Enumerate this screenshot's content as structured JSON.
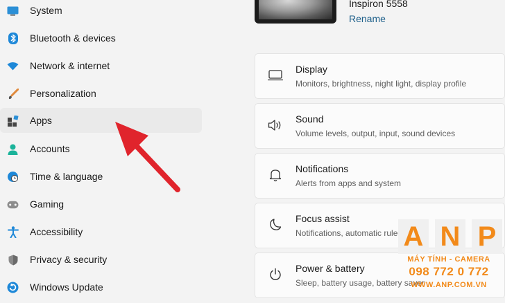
{
  "sidebar": {
    "items": [
      {
        "label": "System",
        "icon": "system-icon"
      },
      {
        "label": "Bluetooth & devices",
        "icon": "bluetooth-icon"
      },
      {
        "label": "Network & internet",
        "icon": "wifi-icon"
      },
      {
        "label": "Personalization",
        "icon": "brush-icon"
      },
      {
        "label": "Apps",
        "icon": "apps-icon"
      },
      {
        "label": "Accounts",
        "icon": "person-icon"
      },
      {
        "label": "Time & language",
        "icon": "clock-globe-icon"
      },
      {
        "label": "Gaming",
        "icon": "gamepad-icon"
      },
      {
        "label": "Accessibility",
        "icon": "accessibility-icon"
      },
      {
        "label": "Privacy & security",
        "icon": "shield-icon"
      },
      {
        "label": "Windows Update",
        "icon": "update-icon"
      }
    ],
    "active": "Apps"
  },
  "device": {
    "name": "Inspiron 5558",
    "rename_label": "Rename"
  },
  "cards": [
    {
      "title": "Display",
      "desc": "Monitors, brightness, night light, display profile",
      "icon": "display-icon"
    },
    {
      "title": "Sound",
      "desc": "Volume levels, output, input, sound devices",
      "icon": "speaker-icon"
    },
    {
      "title": "Notifications",
      "desc": "Alerts from apps and system",
      "icon": "bell-icon"
    },
    {
      "title": "Focus assist",
      "desc": "Notifications, automatic rules",
      "icon": "moon-icon"
    },
    {
      "title": "Power & battery",
      "desc": "Sleep, battery usage, battery saver",
      "icon": "power-icon"
    }
  ],
  "watermark": {
    "letters": [
      "A",
      "N",
      "P"
    ],
    "line1": "MÁY TÍNH - CAMERA",
    "line2": "098 772 0 772",
    "line3": "WWW.ANP.COM.VN",
    "color": "#f28a1a"
  },
  "colors": {
    "accent": "#0067c0",
    "link": "#1d5f8a",
    "annotation_arrow": "#e0242c"
  }
}
